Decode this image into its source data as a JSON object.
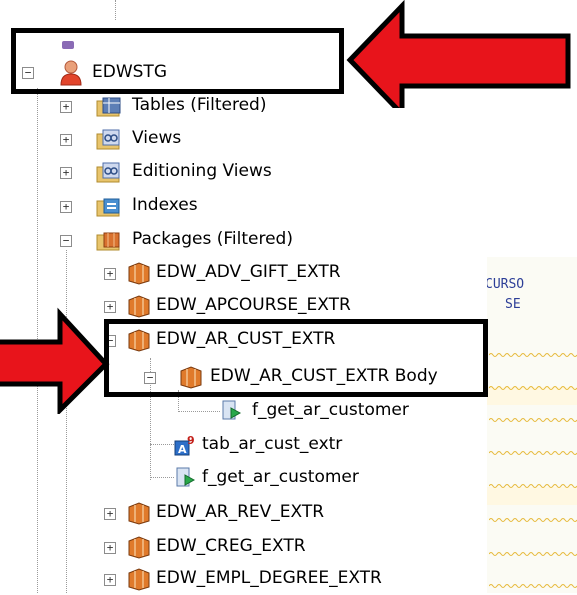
{
  "tree": {
    "root": {
      "label": "EDWSTG",
      "expander": "−",
      "icon": "user-schema-icon"
    },
    "items": [
      {
        "label": "Tables (Filtered)",
        "expander": "+",
        "icon": "tables-folder-icon"
      },
      {
        "label": "Views",
        "expander": "+",
        "icon": "views-folder-icon"
      },
      {
        "label": "Editioning Views",
        "expander": "+",
        "icon": "editioning-views-folder-icon"
      },
      {
        "label": "Indexes",
        "expander": "+",
        "icon": "indexes-folder-icon"
      },
      {
        "label": "Packages (Filtered)",
        "expander": "−",
        "icon": "packages-folder-icon"
      },
      {
        "label": "EDW_ADV_GIFT_EXTR",
        "expander": "+",
        "icon": "package-icon"
      },
      {
        "label": "EDW_APCOURSE_EXTR",
        "expander": "+",
        "icon": "package-icon"
      },
      {
        "label": "EDW_AR_CUST_EXTR",
        "expander": "−",
        "icon": "package-icon"
      },
      {
        "label": "EDW_AR_CUST_EXTR Body",
        "expander": "−",
        "icon": "package-body-icon"
      },
      {
        "label": "f_get_ar_customer",
        "expander": "",
        "icon": "function-icon"
      },
      {
        "label": "tab_ar_cust_extr",
        "expander": "",
        "icon": "type-icon"
      },
      {
        "label": "f_get_ar_customer",
        "expander": "",
        "icon": "function-icon"
      },
      {
        "label": "EDW_AR_REV_EXTR",
        "expander": "+",
        "icon": "package-icon"
      },
      {
        "label": "EDW_CREG_EXTR",
        "expander": "+",
        "icon": "package-icon"
      },
      {
        "label": "EDW_EMPL_DEGREE_EXTR",
        "expander": "+",
        "icon": "package-icon"
      }
    ]
  },
  "editor": {
    "lines": [
      "CURSO",
      "SE"
    ]
  },
  "annotation": {
    "box_color": "#000000",
    "arrow_color": "#e8141b"
  }
}
